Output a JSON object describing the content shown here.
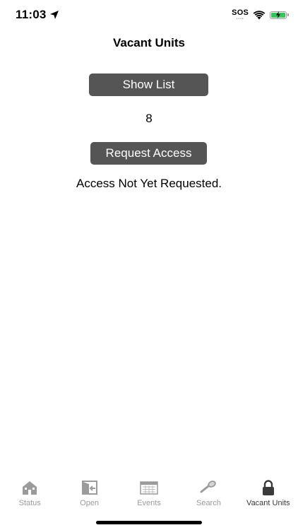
{
  "status_bar": {
    "time": "11:03",
    "carrier": "SOS",
    "sos_dots": "••••"
  },
  "page": {
    "title": "Vacant Units"
  },
  "main": {
    "show_list_label": "Show List",
    "count": "8",
    "request_access_label": "Request Access",
    "access_status": "Access Not Yet Requested."
  },
  "tabs": [
    {
      "label": "Status",
      "icon": "house-icon",
      "active": false
    },
    {
      "label": "Open",
      "icon": "door-arrow-icon",
      "active": false
    },
    {
      "label": "Events",
      "icon": "calendar-icon",
      "active": false
    },
    {
      "label": "Search",
      "icon": "magnifier-icon",
      "active": false
    },
    {
      "label": "Vacant Units",
      "icon": "lock-icon",
      "active": true
    }
  ],
  "colors": {
    "button_bg": "#555555",
    "tab_inactive": "#9b9b9b",
    "tab_active": "#3a3a3a",
    "battery": "#34c759"
  }
}
